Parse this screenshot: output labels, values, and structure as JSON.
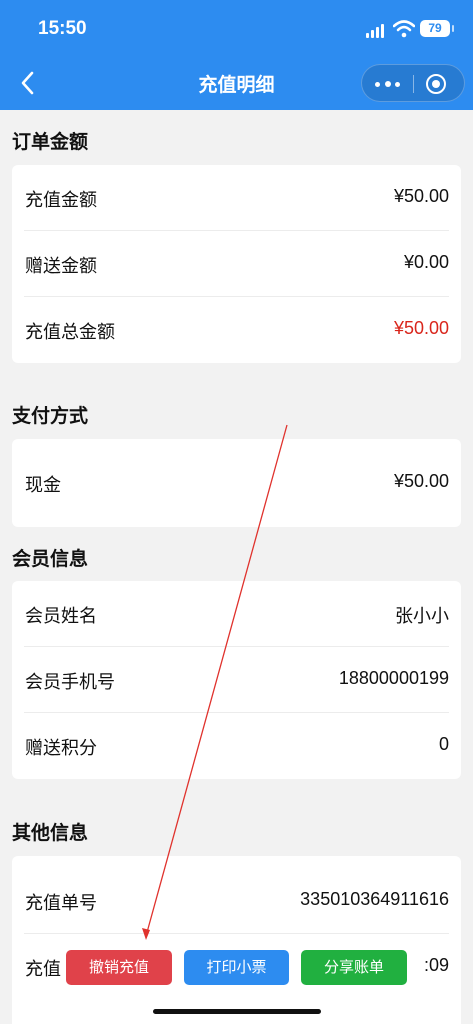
{
  "status_bar": {
    "time": "15:50",
    "battery": "79"
  },
  "nav": {
    "title": "充值明细"
  },
  "sections": [
    {
      "title": "订单金额",
      "rows": [
        {
          "label": "充值金额",
          "value": "¥50.00"
        },
        {
          "label": "赠送金额",
          "value": "¥0.00"
        },
        {
          "label": "充值总金额",
          "value": "¥50.00",
          "color": "#d9261c"
        }
      ]
    },
    {
      "title": "支付方式",
      "rows": [
        {
          "label": "现金",
          "value": "¥50.00"
        }
      ]
    },
    {
      "title": "会员信息",
      "rows": [
        {
          "label": "会员姓名",
          "value": "张小小"
        },
        {
          "label": "会员手机号",
          "value": "18800000199"
        },
        {
          "label": "赠送积分",
          "value": "0"
        }
      ]
    },
    {
      "title": "其他信息",
      "rows": [
        {
          "label": "充值单号",
          "value": "335010364911616"
        },
        {
          "label": "充值",
          "value": ":09"
        }
      ]
    }
  ],
  "actions": {
    "cancel_label": "撤销充值",
    "print_label": "打印小票",
    "share_label": "分享账单"
  },
  "colors": {
    "primary": "#2d8cf0",
    "danger": "#e0424a",
    "success": "#21b040",
    "amount_red": "#d9261c"
  }
}
